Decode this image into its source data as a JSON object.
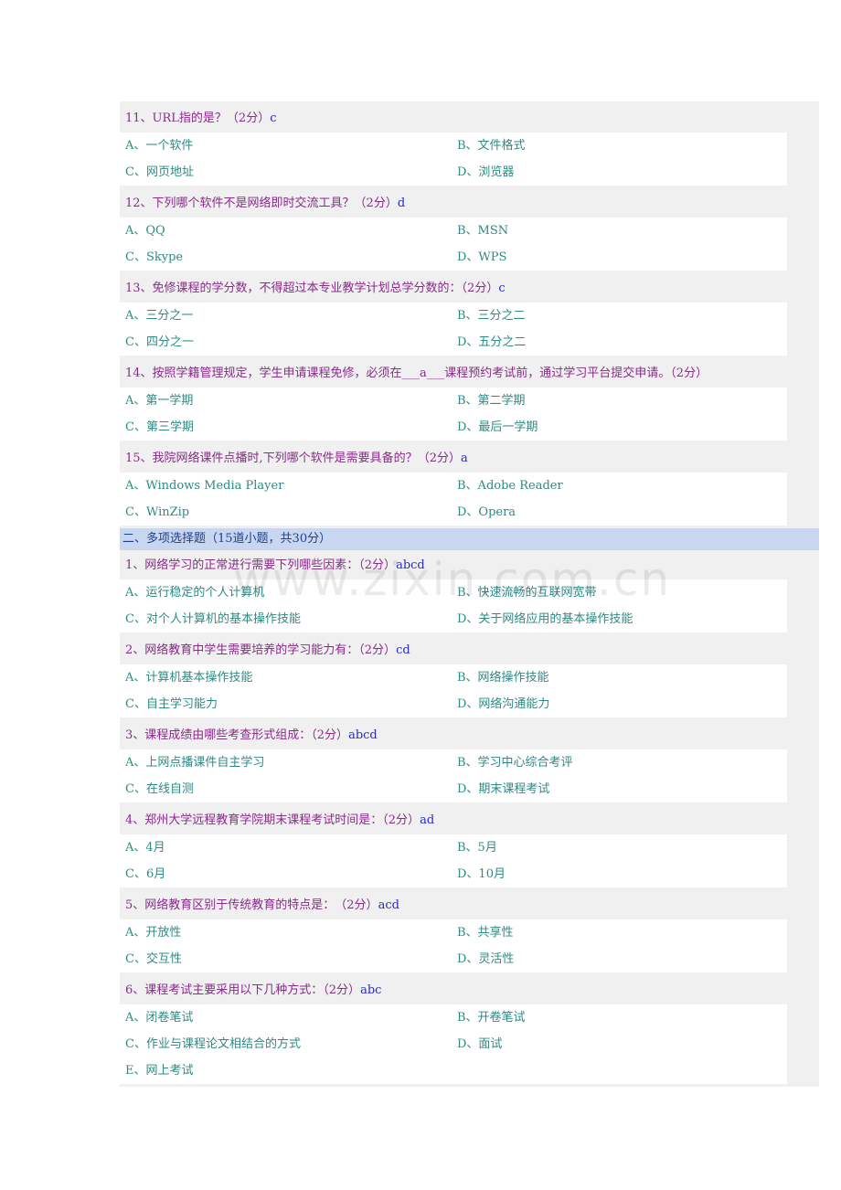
{
  "q11": {
    "title": "11、URL指的是？",
    "score": "（2分）",
    "answer": "c",
    "a": "A、一个软件",
    "b": "B、文件格式",
    "c": "C、网页地址",
    "d": "D、浏览器"
  },
  "q12": {
    "title": "12、下列哪个软件不是网络即时交流工具？",
    "score": "（2分）",
    "answer": "d",
    "a": "A、QQ",
    "b": "B、MSN",
    "c": "C、Skype",
    "d": "D、WPS"
  },
  "q13": {
    "title": "13、免修课程的学分数，不得超过本专业教学计划总学分数的：",
    "score": "（2分）",
    "answer": "c",
    "a": "A、三分之一",
    "b": "B、三分之二",
    "c": "C、四分之一",
    "d": "D、五分之二"
  },
  "q14": {
    "title": "14、按照学籍管理规定，学生申请课程免修，必须在___a___课程预约考试前，通过学习平台提交申请。（2分）",
    "a": "A、第一学期",
    "b": "B、第二学期",
    "c": "C、第三学期",
    "d": "D、最后一学期"
  },
  "q15": {
    "title": "15、我院网络课件点播时,下列哪个软件是需要具备的？",
    "score": "（2分）",
    "answer": "a",
    "a": "A、Windows Media Player",
    "b": "B、Adobe Reader",
    "c": "C、WinZip",
    "d": "D、Opera"
  },
  "section2": "二、多项选择题（15道小题，共30分）",
  "m1": {
    "title": "1、网络学习的正常进行需要下列哪些因素：",
    "score": "（2分）",
    "answer": "abcd",
    "a": "A、运行稳定的个人计算机",
    "b": "B、快速流畅的互联网宽带",
    "c": "C、对个人计算机的基本操作技能",
    "d": "D、关于网络应用的基本操作技能"
  },
  "m2": {
    "title": "2、网络教育中学生需要培养的学习能力有：",
    "score": "（2分）",
    "answer": "cd",
    "a": "A、计算机基本操作技能",
    "b": "B、网络操作技能",
    "c": "C、自主学习能力",
    "d": "D、网络沟通能力"
  },
  "m3": {
    "title": "3、课程成绩由哪些考查形式组成：",
    "score": "（2分）",
    "answer": "abcd",
    "a": "A、上网点播课件自主学习",
    "b": "B、学习中心综合考评",
    "c": "C、在线自测",
    "d": "D、期末课程考试"
  },
  "m4": {
    "title": "4、郑州大学远程教育学院期末课程考试时间是：",
    "score": "（2分）",
    "answer": "ad",
    "a": "A、4月",
    "b": "B、5月",
    "c": "C、6月",
    "d": "D、10月"
  },
  "m5": {
    "title": "5、网络教育区别于传统教育的特点是：　",
    "score": "（2分）",
    "answer": "acd",
    "a": "A、开放性",
    "b": "B、共享性",
    "c": "C、交互性",
    "d": "D、灵活性"
  },
  "m6": {
    "title": "6、课程考试主要采用以下几种方式：",
    "score": "（2分）",
    "answer": "abc",
    "a": "A、闭卷笔试",
    "b": "B、开卷笔试",
    "c": "C、作业与课程论文相结合的方式",
    "d": "D、面试",
    "e": "E、网上考试"
  },
  "watermark": "www.zixin.com.cn"
}
